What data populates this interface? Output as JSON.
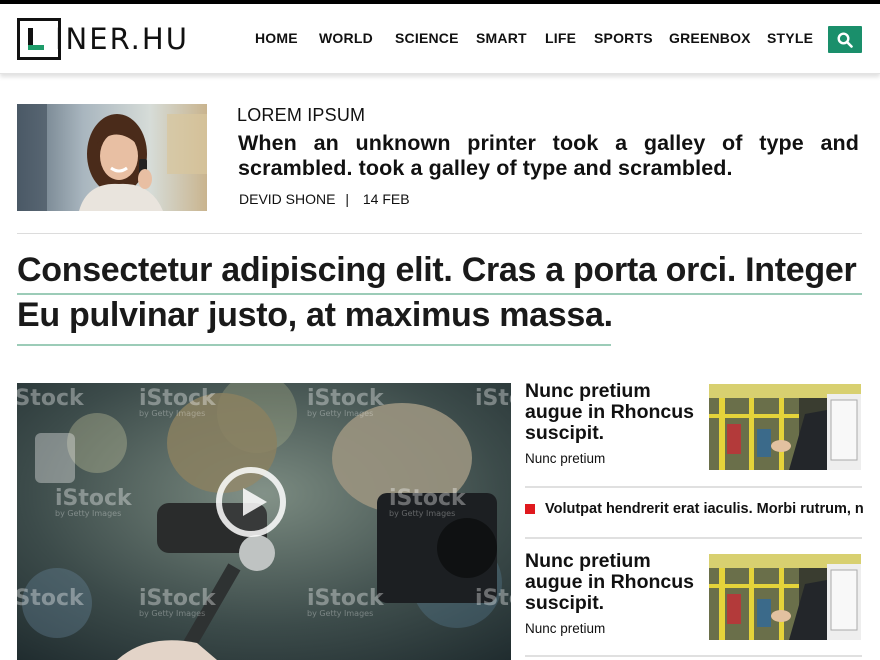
{
  "brand": {
    "logo_text": "INER.HU",
    "logo_letter": "L",
    "accent": "#1a8f6b"
  },
  "nav": {
    "items": [
      "HOME",
      "WORLD",
      "SCIENCE",
      "SMART",
      "LIFE",
      "SPORTS",
      "GREENBOX",
      "STYLE"
    ],
    "search_icon": "search-icon"
  },
  "feature": {
    "category": "LOREM IPSUM",
    "title": "When an unknown printer took a galley of type and scrambled. took a galley of type and scrambled.",
    "author": "DEVID SHONE",
    "separator": "|",
    "date": "14 FEB"
  },
  "headline": {
    "line1": "Consectetur adipiscing elit. Cras a porta orci. Integer",
    "line2": "Eu pulvinar justo, at maximus massa."
  },
  "video": {
    "watermark": "iStock",
    "watermark_sub": "by Getty Images",
    "play_icon": "play-icon"
  },
  "side": {
    "cards": [
      {
        "title": "Nunc pretium augue in Rhoncus suscipit.",
        "subtitle": "Nunc pretium"
      },
      {
        "title": "Nunc pretium augue in Rhoncus suscipit.",
        "subtitle": "Nunc pretium"
      }
    ],
    "ticker": "Volutpat hendrerit erat iaculis. Morbi rutrum, n"
  },
  "colors": {
    "ticker_bullet": "#e0191e",
    "underline": "#9cccb8"
  }
}
